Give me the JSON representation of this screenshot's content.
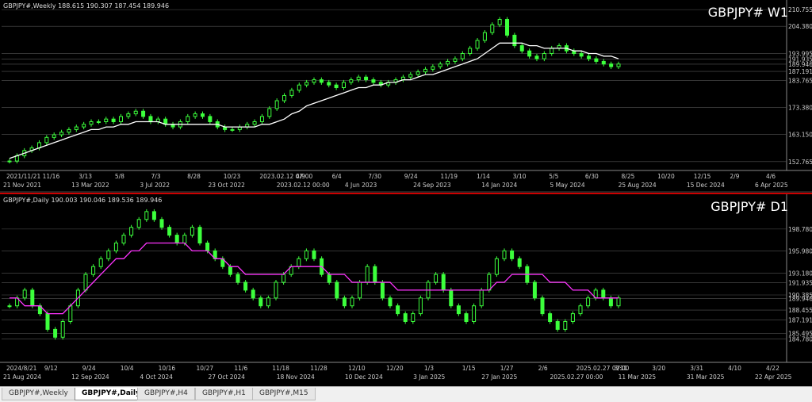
{
  "chart_data": [
    {
      "type": "line",
      "pane": "weekly",
      "header": "GBPJPY#,Weekly  188.615 190.307 187.454 189.946",
      "symbol_label": "GBPJPY# W1",
      "ylim": [
        150,
        212
      ],
      "y_ticks": [
        "210.755",
        "204.380",
        "193.995",
        "191.935",
        "189.946",
        "187.191",
        "183.765",
        "173.380",
        "163.150",
        "152.765"
      ],
      "x_ticks_top": [
        "2021/11/21",
        "11/16",
        "3/13",
        "5/8",
        "7/3",
        "8/28",
        "10/23",
        "2023.02.12 07:00",
        "4/9",
        "6/4",
        "7/30",
        "9/24",
        "11/19",
        "1/14",
        "3/10",
        "5/5",
        "6/30",
        "8/25",
        "10/20",
        "12/15",
        "2/9",
        "4/6"
      ],
      "x_ticks_bottom": [
        "21 Nov 2021",
        "13 Mar 2022",
        "3 Jul 2022",
        "23 Oct 2022",
        "2023.02.12 00:00",
        "4 Jun 2023",
        "24 Sep 2023",
        "14 Jan 2024",
        "5 May 2024",
        "25 Aug 2024",
        "15 Dec 2024",
        "6 Apr 2025"
      ],
      "series": [
        {
          "color": "#3cff3c",
          "values": [
            153,
            155,
            157,
            158,
            160,
            162,
            163,
            164,
            165,
            166,
            167,
            168,
            168,
            169,
            168,
            170,
            171,
            172,
            170,
            168,
            169,
            167,
            166,
            168,
            170,
            171,
            170,
            168,
            166,
            165,
            165,
            166,
            167,
            168,
            170,
            173,
            176,
            178,
            180,
            182,
            183,
            184,
            183,
            182,
            181,
            183,
            184,
            185,
            184,
            183,
            182,
            183,
            184,
            185,
            186,
            187,
            188,
            189,
            190,
            191,
            192,
            194,
            196,
            199,
            202,
            205,
            207,
            201,
            197,
            195,
            193,
            192,
            194,
            196,
            197,
            195,
            194,
            193,
            192,
            191,
            190,
            189,
            190
          ]
        },
        {
          "color": "#ffffff",
          "values": [
            154,
            155,
            156,
            157,
            158,
            159,
            160,
            161,
            162,
            163,
            164,
            165,
            165,
            166,
            166,
            167,
            167,
            168,
            168,
            168,
            168,
            167,
            167,
            167,
            167,
            167,
            167,
            167,
            167,
            166,
            166,
            166,
            166,
            166,
            167,
            167,
            168,
            169,
            171,
            172,
            174,
            175,
            176,
            177,
            178,
            179,
            180,
            181,
            181,
            182,
            182,
            183,
            183,
            184,
            184,
            185,
            186,
            186,
            187,
            188,
            189,
            190,
            191,
            192,
            194,
            196,
            198,
            198,
            198,
            198,
            197,
            197,
            196,
            196,
            196,
            196,
            195,
            195,
            194,
            194,
            193,
            193,
            192
          ]
        }
      ]
    },
    {
      "type": "line",
      "pane": "daily",
      "header": "GBPJPY#,Daily  190.003 190.046 189.536 189.946",
      "symbol_label": "GBPJPY# D1",
      "ylim": [
        182,
        202
      ],
      "y_ticks": [
        "198.780",
        "195.980",
        "193.180",
        "191.935",
        "190.385",
        "189.946",
        "188.455",
        "187.191",
        "185.495",
        "184.780"
      ],
      "x_ticks_top": [
        "2024/8/21",
        "9/12",
        "9/24",
        "10/4",
        "10/16",
        "10/27",
        "11/6",
        "11/18",
        "11/28",
        "12/10",
        "12/20",
        "1/3",
        "1/15",
        "1/27",
        "2/6",
        "2025.02.27 07:00",
        "3/11",
        "3/20",
        "3/31",
        "4/10",
        "4/22"
      ],
      "x_ticks_bottom": [
        "21 Aug 2024",
        "12 Sep 2024",
        "4 Oct 2024",
        "27 Oct 2024",
        "18 Nov 2024",
        "10 Dec 2024",
        "3 Jan 2025",
        "27 Jan 2025",
        "2025.02.27 00:00",
        "11 Mar 2025",
        "31 Mar 2025",
        "22 Apr 2025"
      ],
      "series": [
        {
          "color": "#3cff3c",
          "values": [
            189,
            190,
            191,
            189,
            188,
            186,
            185,
            187,
            189,
            191,
            193,
            194,
            195,
            196,
            197,
            198,
            199,
            200,
            201,
            200,
            199,
            198,
            197,
            198,
            199,
            197,
            196,
            195,
            194,
            193,
            192,
            191,
            190,
            189,
            190,
            192,
            193,
            194,
            195,
            196,
            195,
            193,
            192,
            190,
            189,
            190,
            192,
            194,
            192,
            190,
            189,
            188,
            187,
            188,
            190,
            192,
            193,
            191,
            189,
            188,
            187,
            189,
            191,
            193,
            195,
            196,
            195,
            194,
            192,
            190,
            188,
            187,
            186,
            187,
            188,
            189,
            190,
            191,
            190,
            189,
            190
          ]
        },
        {
          "color": "#ff33ff",
          "values": [
            190,
            190,
            189,
            189,
            189,
            188,
            188,
            188,
            189,
            190,
            191,
            192,
            193,
            194,
            195,
            195,
            196,
            196,
            197,
            197,
            197,
            197,
            197,
            197,
            196,
            196,
            196,
            195,
            195,
            194,
            194,
            193,
            193,
            193,
            193,
            193,
            193,
            194,
            194,
            194,
            194,
            194,
            193,
            193,
            193,
            192,
            192,
            192,
            192,
            192,
            192,
            191,
            191,
            191,
            191,
            191,
            191,
            191,
            191,
            191,
            191,
            191,
            191,
            191,
            192,
            192,
            193,
            193,
            193,
            193,
            193,
            192,
            192,
            192,
            191,
            191,
            191,
            190,
            190,
            190,
            190
          ]
        }
      ]
    }
  ],
  "tabs": [
    "GBPJPY#,Weekly",
    "GBPJPY#,Daily",
    "GBPJPY#,H4",
    "GBPJPY#,H1",
    "GBPJPY#,M15"
  ],
  "active_tab": 1
}
